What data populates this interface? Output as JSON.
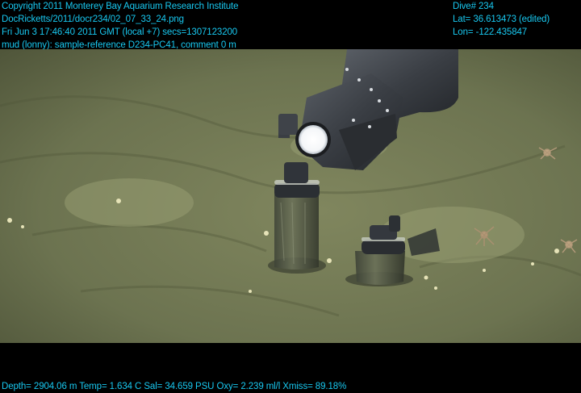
{
  "header": {
    "copyright": "Copyright 2011 Monterey Bay Aquarium Research Institute",
    "file_path": "DocRicketts/2011/docr234/02_07_33_24.png",
    "timestamp": "Fri Jun  3 17:46:40 2011 GMT (local +7)  secs=1307123200",
    "annotation": "mud (lonny): sample-reference D234-PC41, comment 0 m",
    "dive": "Dive# 234",
    "lat": "Lat= 36.613473 (edited)",
    "lon": "Lon= -122.435847"
  },
  "footer": {
    "telemetry": "Depth= 2904.06 m  Temp= 1.634 C  Sal= 34.659 PSU  Oxy= 2.239 ml/l  Xmiss= 89.18%"
  },
  "colors": {
    "overlay_text": "#18c8f0",
    "background": "#000000",
    "sediment": "#6f7550"
  }
}
